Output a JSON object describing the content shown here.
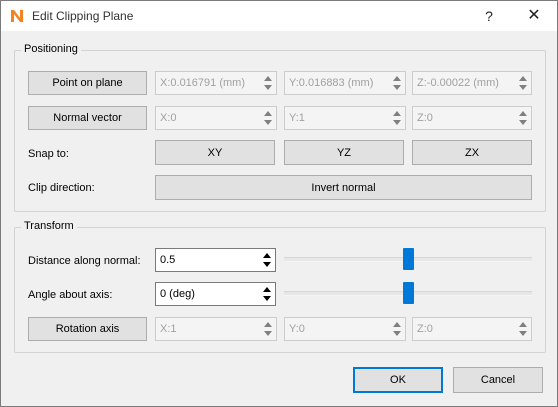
{
  "window": {
    "title": "Edit Clipping Plane",
    "help": "?",
    "close": "✕"
  },
  "positioning": {
    "title": "Positioning",
    "point_button": "Point on plane",
    "point_x": "X:0.016791 (mm)",
    "point_y": "Y:0.016883 (mm)",
    "point_z": "Z:-0.00022 (mm)",
    "normal_button": "Normal vector",
    "normal_x": "X:0",
    "normal_y": "Y:1",
    "normal_z": "Z:0",
    "snap_label": "Snap to:",
    "snap_xy": "XY",
    "snap_yz": "YZ",
    "snap_zx": "ZX",
    "clip_label": "Clip direction:",
    "invert_button": "Invert normal"
  },
  "transform": {
    "title": "Transform",
    "distance_label": "Distance along normal:",
    "distance_value": "0.5",
    "angle_label": "Angle about axis:",
    "angle_value": "0 (deg)",
    "rotation_button": "Rotation axis",
    "axis_x": "X:1",
    "axis_y": "Y:0",
    "axis_z": "Z:0",
    "distance_slider_fraction": 0.5,
    "angle_slider_fraction": 0.5
  },
  "footer": {
    "ok": "OK",
    "cancel": "Cancel"
  },
  "colors": {
    "accent": "#0078d7",
    "app_icon": "#f5821f"
  }
}
